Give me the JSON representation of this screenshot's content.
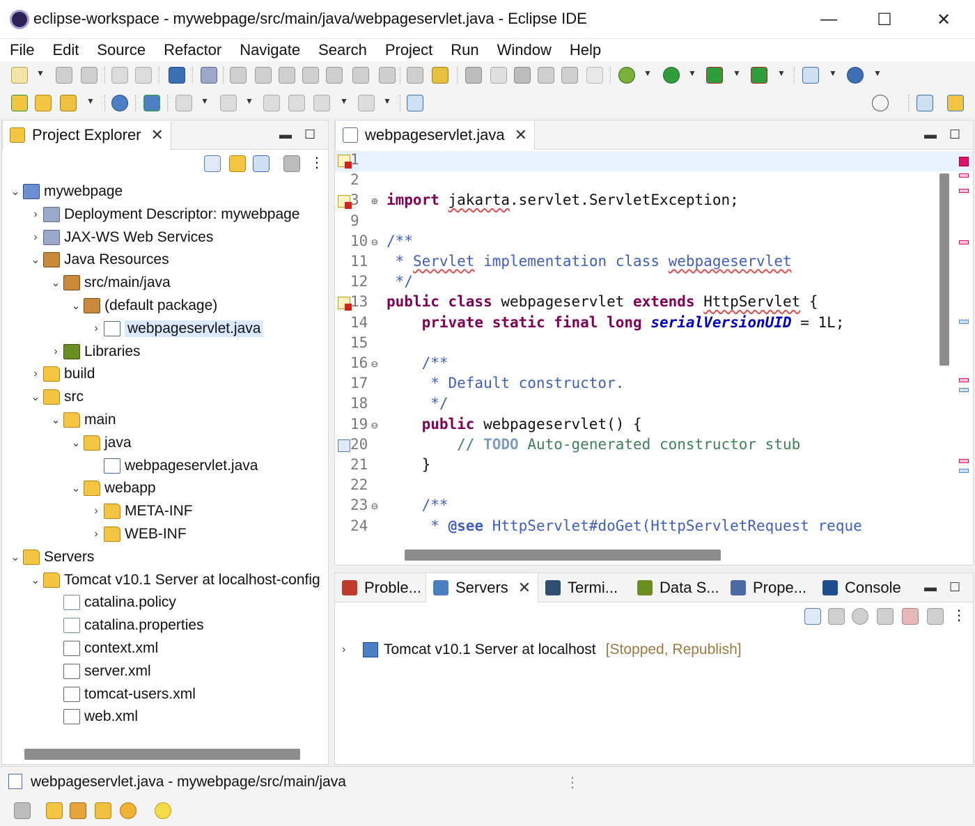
{
  "window": {
    "title": "eclipse-workspace - mywebpage/src/main/java/webpageservlet.java - Eclipse IDE",
    "minimize": "—",
    "maximize": "☐",
    "close": "✕"
  },
  "menu": [
    "File",
    "Edit",
    "Source",
    "Refactor",
    "Navigate",
    "Search",
    "Project",
    "Run",
    "Window",
    "Help"
  ],
  "project_explorer": {
    "tab_label": "Project Explorer",
    "tree": [
      {
        "label": "mywebpage",
        "depth": 0,
        "expanded": true,
        "icon": "project-icon"
      },
      {
        "label": "Deployment Descriptor: mywebpage",
        "depth": 1,
        "expanded": false,
        "icon": "descriptor-icon"
      },
      {
        "label": "JAX-WS Web Services",
        "depth": 1,
        "expanded": false,
        "icon": "webservice-icon"
      },
      {
        "label": "Java Resources",
        "depth": 1,
        "expanded": true,
        "icon": "java-resources-icon"
      },
      {
        "label": "src/main/java",
        "depth": 2,
        "expanded": true,
        "icon": "source-folder-icon"
      },
      {
        "label": "(default package)",
        "depth": 3,
        "expanded": true,
        "icon": "package-icon"
      },
      {
        "label": "webpageservlet.java",
        "depth": 4,
        "expanded": false,
        "icon": "java-file-icon",
        "selected": true
      },
      {
        "label": "Libraries",
        "depth": 2,
        "expanded": false,
        "icon": "library-icon"
      },
      {
        "label": "build",
        "depth": 1,
        "expanded": false,
        "icon": "folder-icon"
      },
      {
        "label": "src",
        "depth": 1,
        "expanded": true,
        "icon": "folder-icon"
      },
      {
        "label": "main",
        "depth": 2,
        "expanded": true,
        "icon": "folder-icon"
      },
      {
        "label": "java",
        "depth": 3,
        "expanded": true,
        "icon": "folder-icon"
      },
      {
        "label": "webpageservlet.java",
        "depth": 4,
        "expanded": null,
        "icon": "java-file-icon"
      },
      {
        "label": "webapp",
        "depth": 3,
        "expanded": true,
        "icon": "folder-icon"
      },
      {
        "label": "META-INF",
        "depth": 4,
        "expanded": false,
        "icon": "folder-icon"
      },
      {
        "label": "WEB-INF",
        "depth": 4,
        "expanded": false,
        "icon": "folder-icon"
      },
      {
        "label": "Servers",
        "depth": 0,
        "expanded": true,
        "icon": "servers-folder-icon"
      },
      {
        "label": "Tomcat v10.1 Server at localhost-config",
        "depth": 1,
        "expanded": true,
        "icon": "folder-icon"
      },
      {
        "label": "catalina.policy",
        "depth": 2,
        "expanded": null,
        "icon": "text-file-icon"
      },
      {
        "label": "catalina.properties",
        "depth": 2,
        "expanded": null,
        "icon": "text-file-icon"
      },
      {
        "label": "context.xml",
        "depth": 2,
        "expanded": null,
        "icon": "xml-file-icon"
      },
      {
        "label": "server.xml",
        "depth": 2,
        "expanded": null,
        "icon": "xml-file-icon"
      },
      {
        "label": "tomcat-users.xml",
        "depth": 2,
        "expanded": null,
        "icon": "xml-file-icon"
      },
      {
        "label": "web.xml",
        "depth": 2,
        "expanded": null,
        "icon": "xml-file-icon"
      }
    ]
  },
  "editor": {
    "tab_label": "webpageservlet.java",
    "lines": [
      {
        "n": "1",
        "marker": "error",
        "fold": "",
        "current": true,
        "html": ""
      },
      {
        "n": "2",
        "marker": "",
        "fold": "",
        "html": ""
      },
      {
        "n": "3",
        "marker": "error",
        "fold": "⊕",
        "html": "<span class='kw'>import</span> <span class='err'>jakarta</span>.servlet.ServletException;"
      },
      {
        "n": "9",
        "marker": "",
        "fold": "",
        "html": ""
      },
      {
        "n": "10",
        "marker": "",
        "fold": "⊖",
        "html": "<span class='jd'>/**</span>"
      },
      {
        "n": "11",
        "marker": "",
        "fold": "",
        "html": "<span class='jd'> * <span class='err'>Servlet</span> implementation class <span class='err'>webpageservlet</span></span>"
      },
      {
        "n": "12",
        "marker": "",
        "fold": "",
        "html": "<span class='jd'> */</span>"
      },
      {
        "n": "13",
        "marker": "error",
        "fold": "",
        "html": "<span class='kw'>public class</span> webpageservlet <span class='kw'>extends</span> <span class='err'>HttpServlet</span> {"
      },
      {
        "n": "14",
        "marker": "",
        "fold": "",
        "html": "    <span class='kw'>private static final long</span> <span class='fld'>serialVersionUID</span> = 1L;"
      },
      {
        "n": "15",
        "marker": "",
        "fold": "",
        "html": ""
      },
      {
        "n": "16",
        "marker": "",
        "fold": "⊖",
        "html": "    <span class='jd'>/**</span>"
      },
      {
        "n": "17",
        "marker": "",
        "fold": "",
        "html": "<span class='jd'>     * Default constructor.</span>"
      },
      {
        "n": "18",
        "marker": "",
        "fold": "",
        "html": "<span class='jd'>     */</span>"
      },
      {
        "n": "19",
        "marker": "",
        "fold": "⊖",
        "html": "    <span class='kw'>public</span> webpageservlet() {"
      },
      {
        "n": "20",
        "marker": "task",
        "fold": "",
        "html": "        <span class='cm'>// <span class='todo'>TODO</span> Auto-generated constructor stub</span>"
      },
      {
        "n": "21",
        "marker": "",
        "fold": "",
        "html": "    }"
      },
      {
        "n": "22",
        "marker": "",
        "fold": "",
        "html": ""
      },
      {
        "n": "23",
        "marker": "",
        "fold": "⊖",
        "html": "    <span class='jd'>/**</span>"
      },
      {
        "n": "24",
        "marker": "",
        "fold": "",
        "html": "<span class='jd'>     * <b>@see</b> HttpServlet#doGet(HttpServletRequest reque</span>"
      }
    ]
  },
  "bottom_panel": {
    "tabs": [
      {
        "label": "Proble...",
        "icon": "problems-icon",
        "color": "#c0392b"
      },
      {
        "label": "Servers",
        "icon": "servers-icon",
        "color": "#4d7fc5",
        "active": true
      },
      {
        "label": "Termi...",
        "icon": "terminal-icon",
        "color": "#2f4f6f"
      },
      {
        "label": "Data S...",
        "icon": "data-source-icon",
        "color": "#6b8e23"
      },
      {
        "label": "Prope...",
        "icon": "properties-icon",
        "color": "#4a6aa8"
      },
      {
        "label": "Console",
        "icon": "console-icon",
        "color": "#1f4d8f"
      }
    ],
    "server": {
      "name": "Tomcat v10.1 Server at localhost",
      "status": "[Stopped, Republish]"
    }
  },
  "status_bar": {
    "text": "webpageservlet.java - mywebpage/src/main/java"
  },
  "colors": {
    "keyword": "#7f0055",
    "javadoc": "#3f5fbf",
    "comment": "#3f7f5f",
    "field": "#0000c0",
    "selection": "#d9e8fb"
  }
}
